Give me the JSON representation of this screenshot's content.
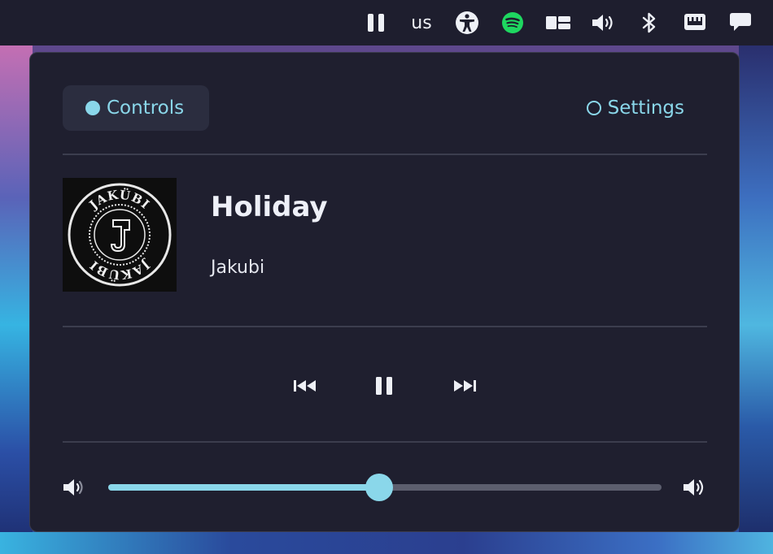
{
  "topbar": {
    "keyboard_layout": "us",
    "icons": [
      "pause-icon",
      "keyboard-layout",
      "accessibility-icon",
      "spotify-icon",
      "layout-icon",
      "volume-icon",
      "bluetooth-icon",
      "network-icon",
      "notifications-icon"
    ]
  },
  "tabs": {
    "controls_label": "Controls",
    "settings_label": "Settings",
    "active": "Controls"
  },
  "track": {
    "title": "Holiday",
    "artist": "Jakubi",
    "cover_text": "JAKÜBI"
  },
  "volume": {
    "level": 0.49
  },
  "colors": {
    "accent": "#8ad7ea",
    "panel_bg": "#1f1f2f",
    "bar_bg": "#1e1e2e",
    "spotify_green": "#1ed760"
  }
}
